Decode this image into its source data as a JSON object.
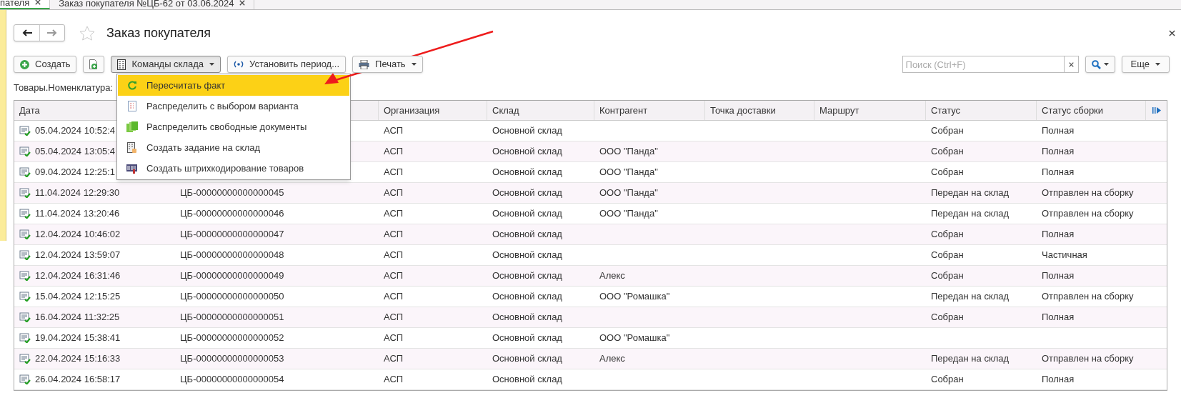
{
  "tabs": [
    {
      "label": "пателя",
      "selected": true
    },
    {
      "label": "Заказ покупателя №ЦБ-62 от 03.06.2024",
      "selected": false
    }
  ],
  "window": {
    "title": "Заказ покупателя"
  },
  "toolbar": {
    "create": "Создать",
    "warehouse_commands": {
      "label": "Команды склада",
      "expanded": true
    },
    "set_period": "Установить период...",
    "print": "Печать",
    "search": {
      "placeholder": "Поиск (Ctrl+F)"
    },
    "more": "Еще"
  },
  "menu": {
    "items": [
      {
        "label": "Пересчитать факт",
        "selected": true
      },
      {
        "label": "Распределить с выбором варианта",
        "selected": false
      },
      {
        "label": "Распределить свободные документы",
        "selected": false
      },
      {
        "label": "Создать задание на склад",
        "selected": false
      },
      {
        "label": "Создать штрихкодирование товаров",
        "selected": false
      }
    ]
  },
  "filter_label": "Товары.Номенклатура:",
  "table": {
    "columns": [
      "Дата",
      "",
      "Организация",
      "Склад",
      "Контрагент",
      "Точка доставки",
      "Маршрут",
      "Статус",
      "Статус сборки"
    ],
    "rows": [
      {
        "date": "05.04.2024 10:52:4",
        "number": "",
        "org": "АСП",
        "warehouse": "Основной склад",
        "counterparty": "",
        "status": "Собран",
        "assembly": "Полная"
      },
      {
        "date": "05.04.2024 13:05:4",
        "number": "",
        "org": "АСП",
        "warehouse": "Основной склад",
        "counterparty": "ООО \"Панда\"",
        "status": "Собран",
        "assembly": "Полная"
      },
      {
        "date": "09.04.2024 12:25:1",
        "number": "",
        "org": "АСП",
        "warehouse": "Основной склад",
        "counterparty": "ООО \"Панда\"",
        "status": "Собран",
        "assembly": "Полная"
      },
      {
        "date": "11.04.2024 12:29:30",
        "number": "ЦБ-00000000000000045",
        "org": "АСП",
        "warehouse": "Основной склад",
        "counterparty": "ООО \"Панда\"",
        "status": "Передан на склад",
        "assembly": "Отправлен на сборку"
      },
      {
        "date": "11.04.2024 13:20:46",
        "number": "ЦБ-00000000000000046",
        "org": "АСП",
        "warehouse": "Основной склад",
        "counterparty": "ООО \"Панда\"",
        "status": "Передан на склад",
        "assembly": "Отправлен на сборку"
      },
      {
        "date": "12.04.2024 10:46:02",
        "number": "ЦБ-00000000000000047",
        "org": "АСП",
        "warehouse": "Основной склад",
        "counterparty": "",
        "status": "Собран",
        "assembly": "Полная"
      },
      {
        "date": "12.04.2024 13:59:07",
        "number": "ЦБ-00000000000000048",
        "org": "АСП",
        "warehouse": "Основной склад",
        "counterparty": "",
        "status": "Собран",
        "assembly": "Частичная"
      },
      {
        "date": "12.04.2024 16:31:46",
        "number": "ЦБ-00000000000000049",
        "org": "АСП",
        "warehouse": "Основной склад",
        "counterparty": "Алекс",
        "status": "Собран",
        "assembly": "Полная"
      },
      {
        "date": "15.04.2024 12:15:25",
        "number": "ЦБ-00000000000000050",
        "org": "АСП",
        "warehouse": "Основной склад",
        "counterparty": "ООО \"Ромашка\"",
        "status": "Передан на склад",
        "assembly": "Отправлен на сборку"
      },
      {
        "date": "16.04.2024 11:32:25",
        "number": "ЦБ-00000000000000051",
        "org": "АСП",
        "warehouse": "Основной склад",
        "counterparty": "",
        "status": "Собран",
        "assembly": "Полная"
      },
      {
        "date": "19.04.2024 15:38:41",
        "number": "ЦБ-00000000000000052",
        "org": "АСП",
        "warehouse": "Основной склад",
        "counterparty": "ООО \"Ромашка\"",
        "status": "",
        "assembly": ""
      },
      {
        "date": "22.04.2024 15:16:33",
        "number": "ЦБ-00000000000000053",
        "org": "АСП",
        "warehouse": "Основной склад",
        "counterparty": "Алекс",
        "status": "Передан на склад",
        "assembly": "Отправлен на сборку"
      },
      {
        "date": "26.04.2024 16:58:17",
        "number": "ЦБ-00000000000000054",
        "org": "АСП",
        "warehouse": "Основной склад",
        "counterparty": "",
        "status": "Собран",
        "assembly": "Полная"
      }
    ]
  }
}
